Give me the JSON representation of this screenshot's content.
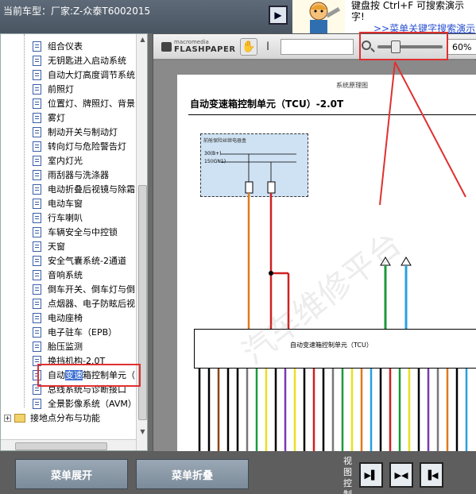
{
  "topbar": {
    "car_label": "当前车型：厂家:Z-众泰T6002015",
    "tip_text": "键盘按 Ctrl+F 可搜索演示\n字!",
    "tip_link": ">>菜单关键字搜索演示"
  },
  "tree": {
    "items": [
      "组合仪表",
      "无钥匙进入启动系统",
      "自动大灯高度调节系统",
      "前照灯",
      "位置灯、牌照灯、背景",
      "雾灯",
      "制动开关与制动灯",
      "转向灯与危险警告灯",
      "室内灯光",
      "雨刮器与洗涤器",
      "电动折叠后视镜与除霜",
      "电动车窗",
      "行车喇叭",
      "车辆安全与中控锁",
      "天窗",
      "安全气囊系统-2通道",
      "音响系统",
      "倒车开关、倒车灯与倒",
      "点烟器、电子防眩后视",
      "电动座椅",
      "电子驻车（EPB）",
      "胎压监测",
      "换挡机构-2.0T"
    ],
    "selected": {
      "before": "自动",
      "highlight": "变速",
      "after": "箱控制单元（"
    },
    "after_selected": [
      "总线系统与诊断接口",
      "全景影像系统（AVM）"
    ],
    "folder_item": "接地点分布与功能"
  },
  "viewer": {
    "logo_top": "macromedia",
    "logo_bottom": "FLASHPAPER",
    "zoom_value": "60%",
    "zoom_fraction": 0.28
  },
  "document": {
    "header": "系统原理图",
    "title": "自动变速箱控制单元（TCU）-2.0T",
    "box_label": "前舱保险丝继电器盒",
    "rail_30": "30(B+)",
    "rail_15": "15(IGN1)",
    "tcu_label": "自动变速箱控制单元（TCU）",
    "watermark": "汽车维修平台"
  },
  "bottom": {
    "expand_label": "菜单展开",
    "collapse_label": "菜单折叠",
    "view_label": "视图控制"
  },
  "colors": {
    "highlight_box": "#e03030",
    "tree_selection": "#3b6fd4"
  }
}
